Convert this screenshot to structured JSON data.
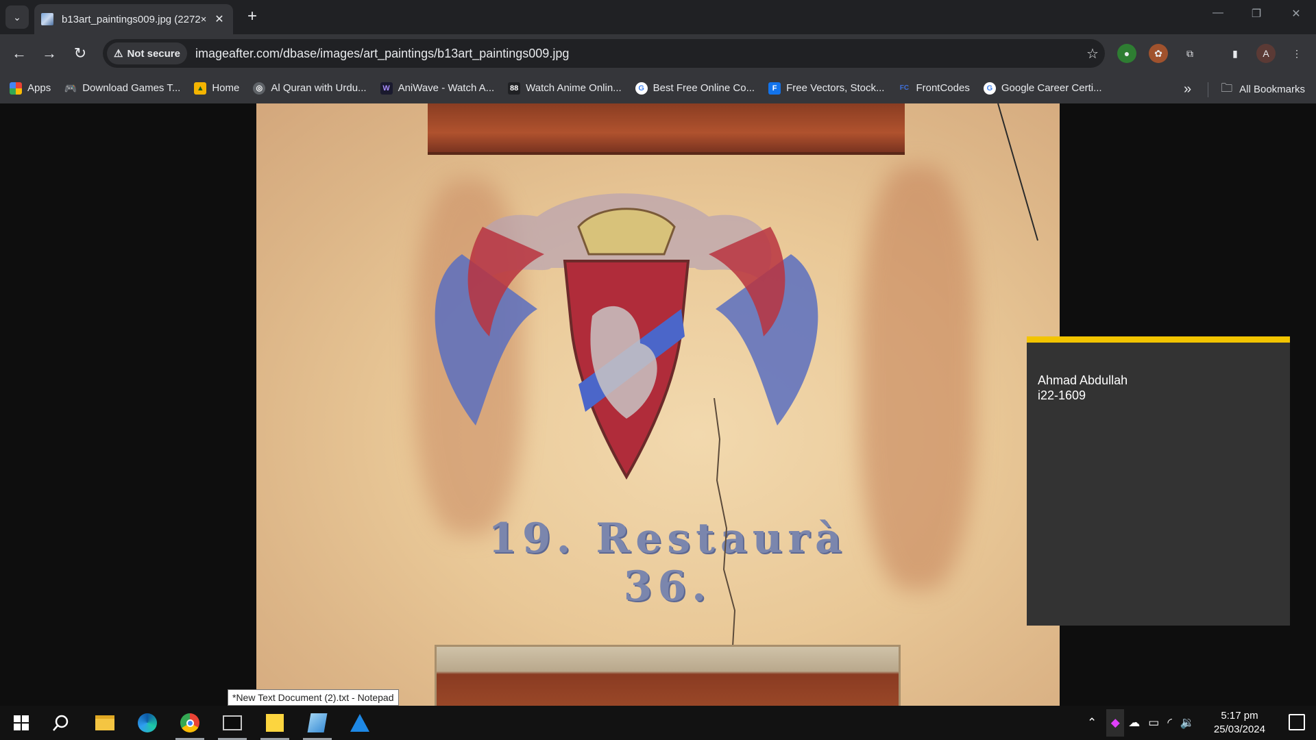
{
  "tab": {
    "title": "b13art_paintings009.jpg (2272×",
    "close": "✕",
    "new_tab": "+"
  },
  "window": {
    "minimize": "—",
    "restore": "❐",
    "close": "✕"
  },
  "toolbar": {
    "security_label": "Not secure",
    "url": "imageafter.com/dbase/images/art_paintings/b13art_paintings009.jpg",
    "profile_initial": "A"
  },
  "bookmarks": {
    "items": [
      {
        "label": "Apps",
        "icon": "apps-grid-icon"
      },
      {
        "label": "Download Games T...",
        "icon": "gamepad-icon"
      },
      {
        "label": "Home",
        "icon": "home-icon"
      },
      {
        "label": "Al Quran with Urdu...",
        "icon": "globe-icon"
      },
      {
        "label": "AniWave - Watch A...",
        "icon": "aniwave-icon"
      },
      {
        "label": "Watch Anime Onlin...",
        "icon": "anime-site-icon"
      },
      {
        "label": "Best Free Online Co...",
        "icon": "google-icon"
      },
      {
        "label": "Free Vectors, Stock...",
        "icon": "freepik-icon"
      },
      {
        "label": "FrontCodes",
        "icon": "frontcodes-icon"
      },
      {
        "label": "Google Career Certi...",
        "icon": "google-icon"
      }
    ],
    "overflow": "»",
    "all_bookmarks": "All Bookmarks"
  },
  "image": {
    "inscription": "19. Restaurà 36."
  },
  "overlay": {
    "name": "Ahmad Abdullah",
    "id": "i22-1609",
    "accent": "#f2c400"
  },
  "tooltip": "*New Text Document (2).txt - Notepad",
  "taskbar": {
    "time": "5:17 pm",
    "date": "25/03/2024"
  }
}
